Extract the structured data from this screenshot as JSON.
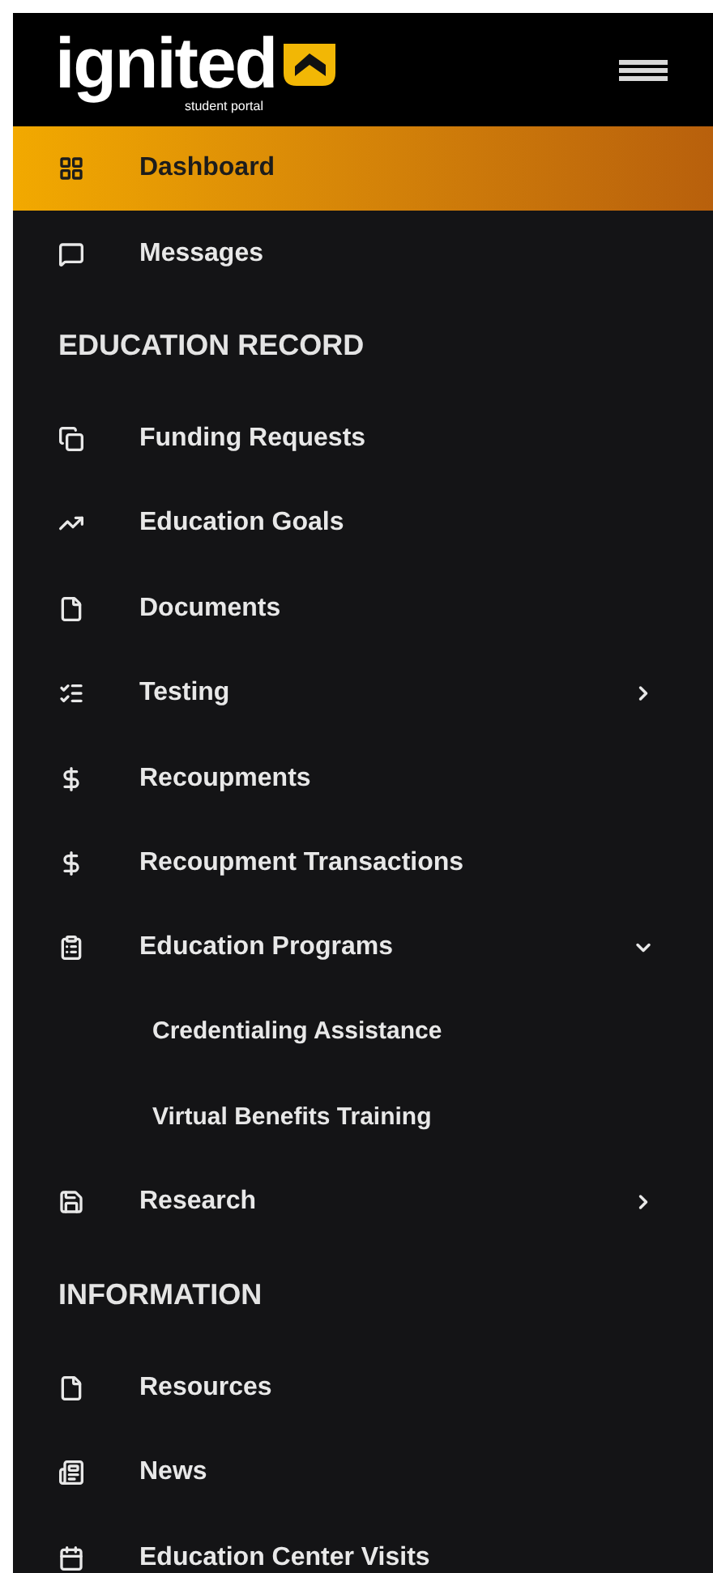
{
  "header": {
    "logo_text": "ignited",
    "logo_subtitle": "student portal"
  },
  "nav": [
    {
      "label": "Dashboard",
      "selected": true
    },
    {
      "label": "Messages",
      "selected": false
    }
  ],
  "sections": [
    {
      "title": "EDUCATION RECORD",
      "items": [
        {
          "label": "Funding Requests",
          "selected": false,
          "kind": "link"
        },
        {
          "label": "Education Goals",
          "selected": false,
          "kind": "link"
        },
        {
          "label": "Documents",
          "selected": false,
          "kind": "link"
        },
        {
          "label": "Testing",
          "selected": false,
          "kind": "group",
          "expanded": false
        },
        {
          "label": "Recoupments",
          "selected": false,
          "kind": "link"
        },
        {
          "label": "Recoupment Transactions",
          "selected": false,
          "kind": "link"
        },
        {
          "label": "Education Programs",
          "selected": false,
          "kind": "group",
          "expanded": true,
          "children": [
            {
              "label": "Credentialing Assistance",
              "selected": false
            },
            {
              "label": "Virtual Benefits Training",
              "selected": false
            }
          ]
        },
        {
          "label": "Research",
          "selected": false,
          "kind": "group",
          "expanded": false
        }
      ]
    },
    {
      "title": "INFORMATION",
      "items": [
        {
          "label": "Resources",
          "selected": false,
          "kind": "link"
        },
        {
          "label": "News",
          "selected": false,
          "kind": "link"
        },
        {
          "label": "Education Center Visits",
          "selected": false,
          "kind": "link"
        }
      ]
    }
  ]
}
